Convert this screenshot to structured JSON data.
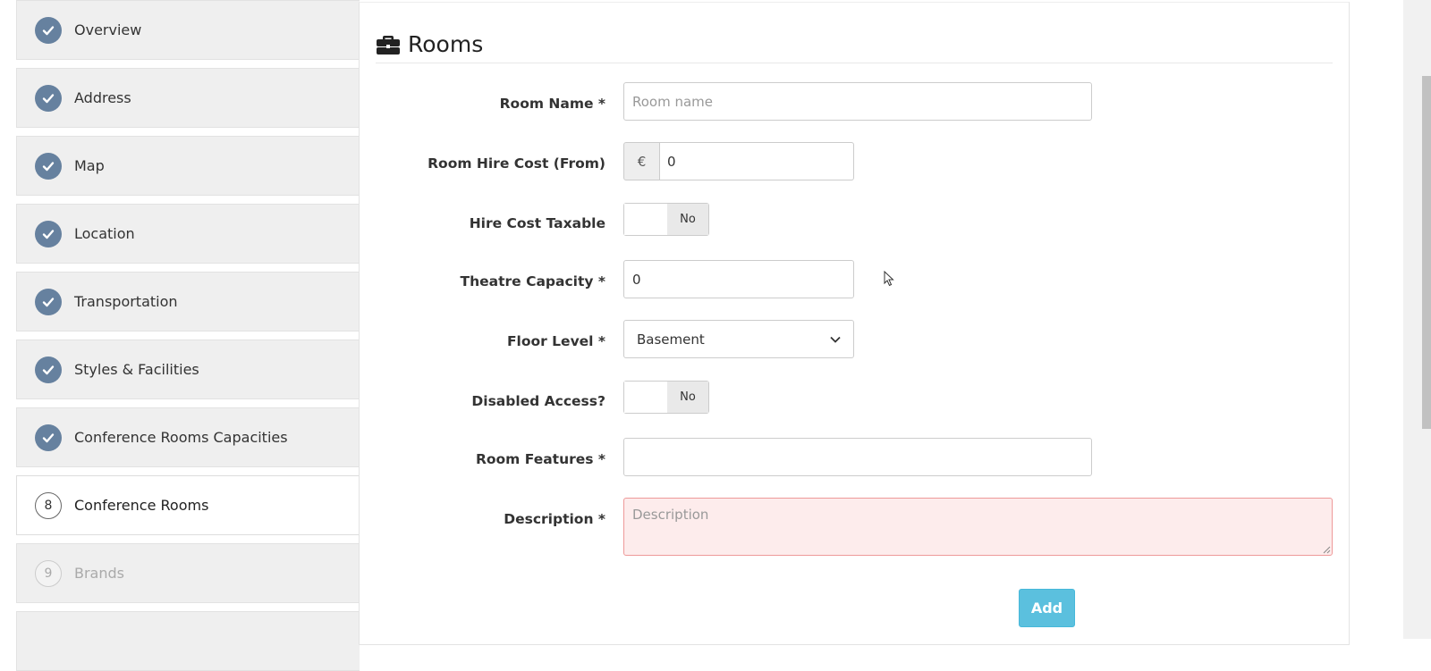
{
  "sidebar": {
    "items": [
      {
        "number": "",
        "label": "Overview",
        "state": "done"
      },
      {
        "number": "",
        "label": "Address",
        "state": "done"
      },
      {
        "number": "",
        "label": "Map",
        "state": "done"
      },
      {
        "number": "",
        "label": "Location",
        "state": "done"
      },
      {
        "number": "",
        "label": "Transportation",
        "state": "done"
      },
      {
        "number": "",
        "label": "Styles & Facilities",
        "state": "done"
      },
      {
        "number": "",
        "label": "Conference Rooms Capacities",
        "state": "done"
      },
      {
        "number": "8",
        "label": "Conference Rooms",
        "state": "active"
      },
      {
        "number": "9",
        "label": "Brands",
        "state": "future"
      }
    ]
  },
  "panel": {
    "title": "Rooms",
    "icon": "briefcase-icon"
  },
  "form": {
    "room_name": {
      "label": "Room Name *",
      "placeholder": "Room name",
      "value": ""
    },
    "hire_cost": {
      "label": "Room Hire Cost (From)",
      "currency": "€",
      "value": "0"
    },
    "hire_taxable": {
      "label": "Hire Cost Taxable",
      "state": "No"
    },
    "theatre_capacity": {
      "label": "Theatre Capacity *",
      "value": "0"
    },
    "floor_level": {
      "label": "Floor Level *",
      "selected": "Basement"
    },
    "disabled_access": {
      "label": "Disabled Access?",
      "state": "No"
    },
    "room_features": {
      "label": "Room Features *",
      "value": ""
    },
    "description": {
      "label": "Description *",
      "placeholder": "Description"
    },
    "add_label": "Add"
  },
  "colors": {
    "step_done": "#66819f",
    "add_button": "#5bc0de",
    "error_bg": "#fdecec"
  }
}
